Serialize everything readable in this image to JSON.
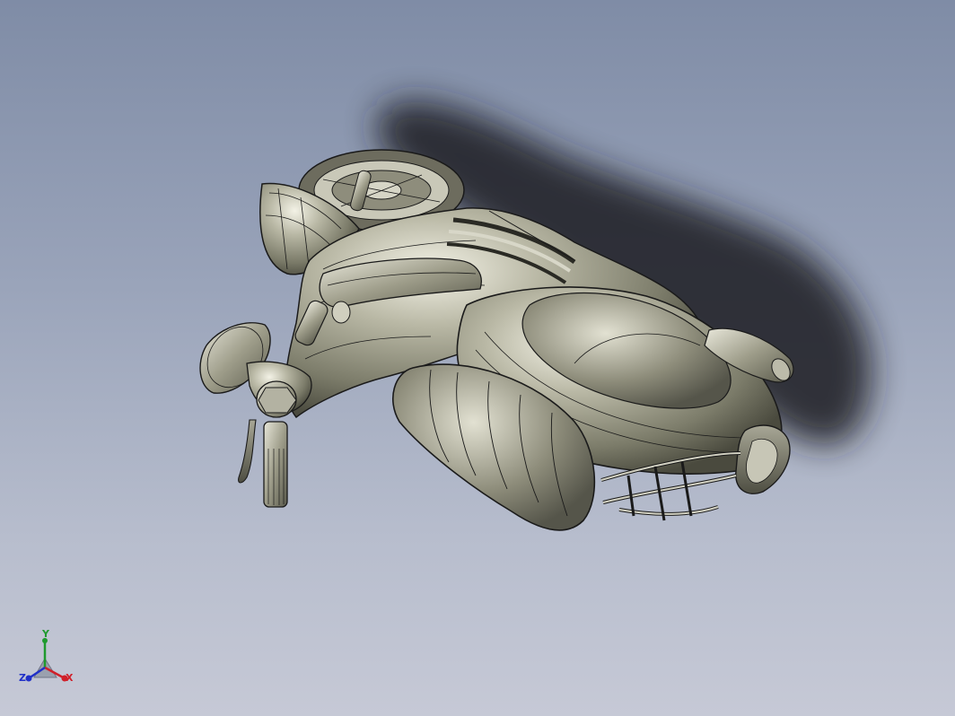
{
  "triad": {
    "x_label": "X",
    "y_label": "Y",
    "z_label": "Z",
    "x_color": "#d0202a",
    "y_color": "#1f9a2e",
    "z_color": "#2030c8"
  },
  "model": {
    "body_color": "#8a8a78",
    "edge_color": "#1a1a1a",
    "shadow_color": "#15151a"
  }
}
